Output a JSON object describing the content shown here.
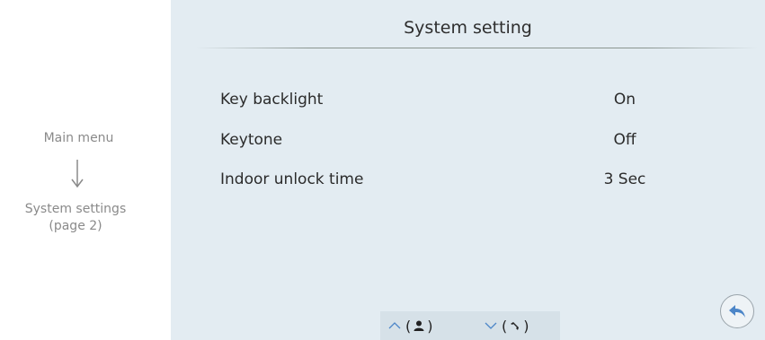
{
  "sidebar": {
    "main_menu": "Main menu",
    "current_page_line1": "System settings",
    "current_page_line2": "(page 2)"
  },
  "screen": {
    "title": "System setting",
    "rows": [
      {
        "label": "Key backlight",
        "value": "On"
      },
      {
        "label": "Keytone",
        "value": "Off"
      },
      {
        "label": "Indoor unlock time",
        "value": "3 Sec"
      }
    ],
    "nav": {
      "up_icon": "chevron-up-icon",
      "up_glyph": "person-icon",
      "down_icon": "chevron-down-icon",
      "down_glyph": "handset-icon"
    },
    "back_icon": "back-arrow-icon"
  },
  "colors": {
    "screen_bg": "#e3ecf2",
    "accent_blue": "#4c86c8",
    "sidebar_text": "#8a8a8a"
  }
}
